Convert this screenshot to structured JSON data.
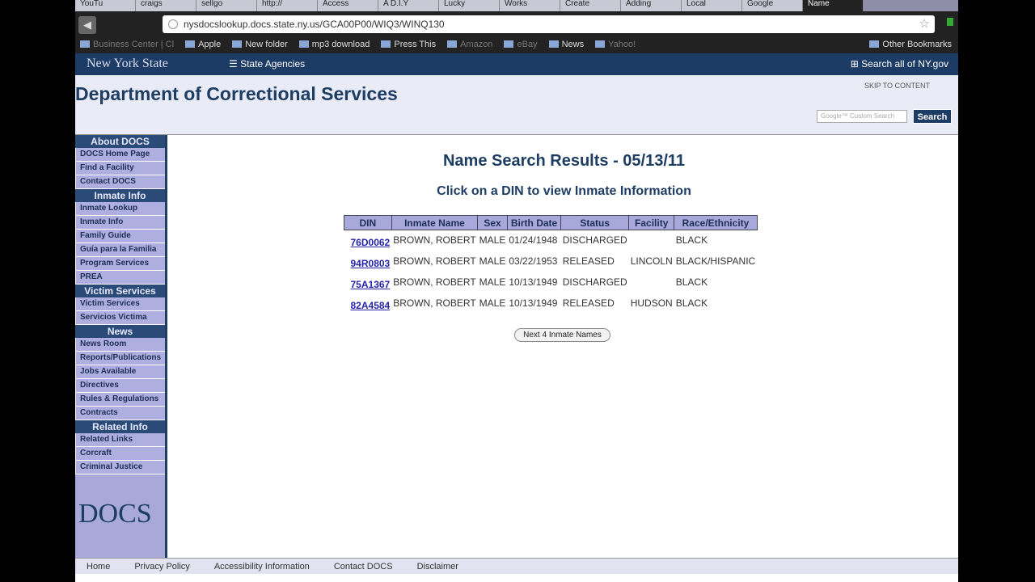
{
  "browser": {
    "tabs": [
      "YouTu",
      "craigs",
      "sellgo",
      "http://",
      "Access",
      "A D.I.Y",
      "Lucky",
      "Works",
      "Create",
      "Adding",
      "Local",
      "Google",
      "Name"
    ],
    "url": "nysdocslookup.docs.state.ny.us/GCA00P00/WIQ3/WINQ130",
    "bookmarks": [
      "Business Center | Cl",
      "Apple",
      "New folder",
      "mp3 download",
      "Press This",
      "Amazon",
      "eBay",
      "News",
      "Yahoo!"
    ],
    "other_bookmarks": "Other Bookmarks"
  },
  "nybar": {
    "logo": "New York State",
    "agencies": "State Agencies",
    "search": "Search all of NY.gov"
  },
  "header": {
    "title": "Department of Correctional Services",
    "skip": "SKIP TO CONTENT",
    "search_placeholder": "Google™ Custom Search",
    "search_button": "Search"
  },
  "sidebar": [
    {
      "heading": "About DOCS",
      "items": [
        "DOCS Home Page",
        "Find a Facility",
        "Contact DOCS"
      ]
    },
    {
      "heading": "Inmate Info",
      "items": [
        "Inmate Lookup",
        "Inmate Info",
        "Family Guide",
        "Guía para la Familia",
        "Program Services",
        "PREA"
      ]
    },
    {
      "heading": "Victim Services",
      "items": [
        "Victim Services",
        "Servicios Victima"
      ]
    },
    {
      "heading": "News",
      "items": [
        "News Room",
        "Reports/Publications",
        "Jobs Available",
        "Directives",
        "Rules & Regulations",
        "Contracts"
      ]
    },
    {
      "heading": "Related Info",
      "items": [
        "Related Links",
        "Corcraft",
        "Criminal Justice"
      ]
    }
  ],
  "sidebar_logo": "DOCS",
  "main": {
    "title": "Name Search Results - 05/13/11",
    "subtitle": "Click on a DIN to view Inmate Information",
    "columns": [
      "DIN",
      "Inmate Name",
      "Sex",
      "Birth Date",
      "Status",
      "Facility",
      "Race/Ethnicity"
    ],
    "rows": [
      [
        "76D0062",
        "BROWN, ROBERT",
        "MALE",
        "01/24/1948",
        "DISCHARGED",
        "",
        "BLACK"
      ],
      [
        "94R0803",
        "BROWN, ROBERT",
        "MALE",
        "03/22/1953",
        "RELEASED",
        "LINCOLN",
        "BLACK/HISPANIC"
      ],
      [
        "75A1367",
        "BROWN, ROBERT",
        "MALE",
        "10/13/1949",
        "DISCHARGED",
        "",
        "BLACK"
      ],
      [
        "82A4584",
        "BROWN, ROBERT",
        "MALE",
        "10/13/1949",
        "RELEASED",
        "HUDSON",
        "BLACK"
      ]
    ],
    "next_button": "Next 4 Inmate Names"
  },
  "footer": [
    "Home",
    "Privacy Policy",
    "Accessibility Information",
    "Contact DOCS",
    "Disclaimer"
  ]
}
